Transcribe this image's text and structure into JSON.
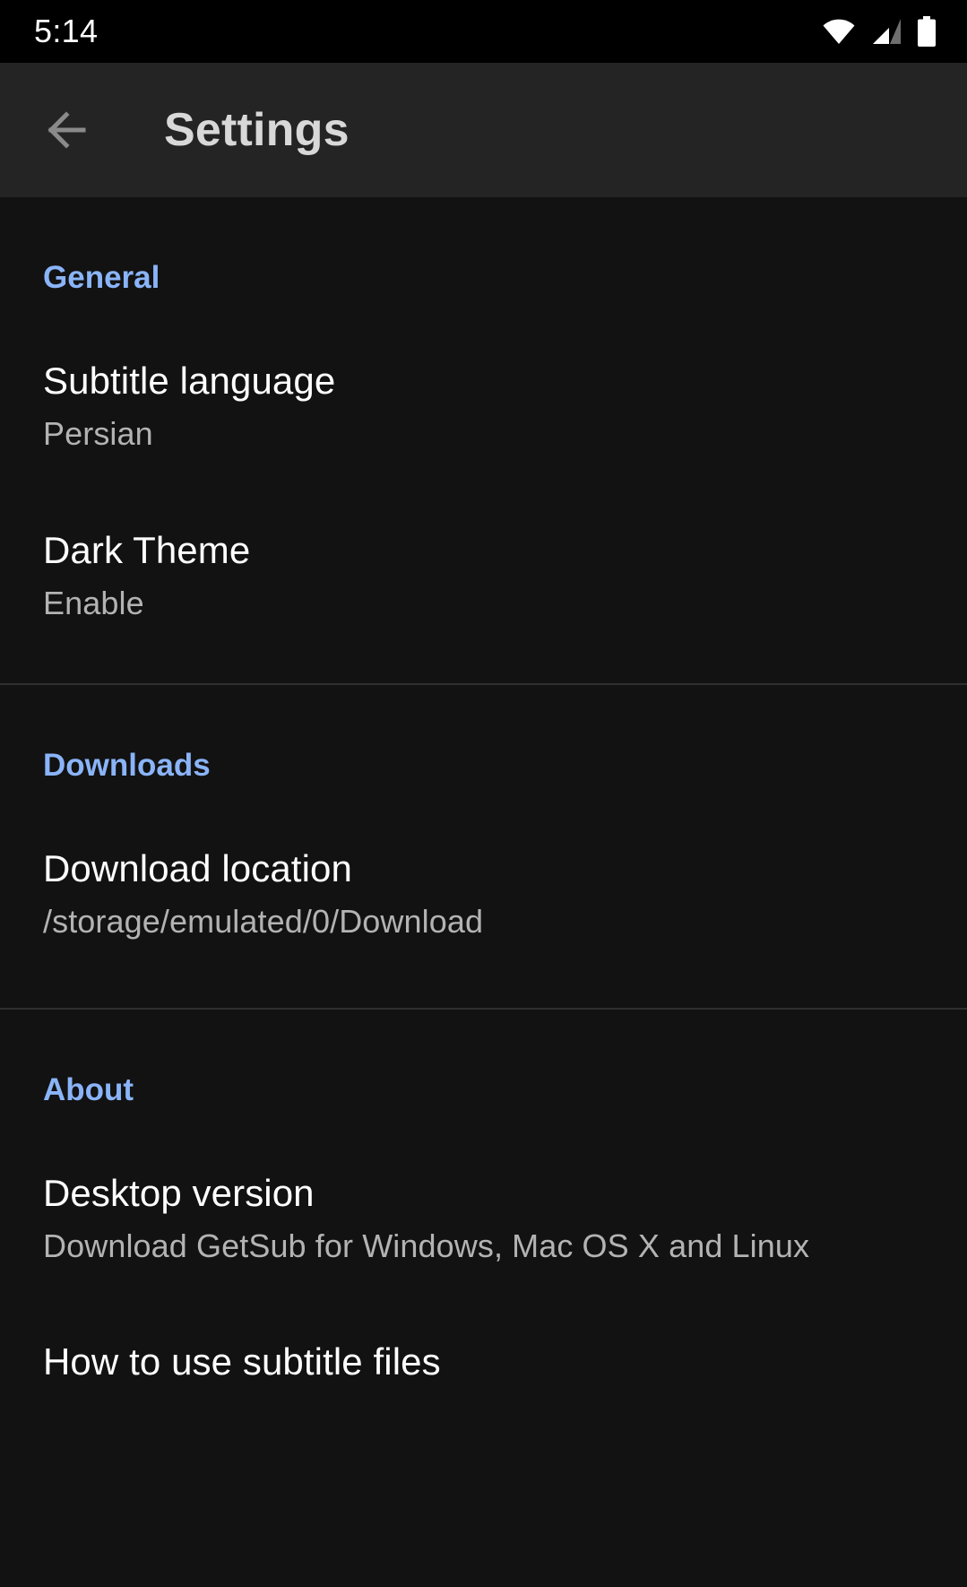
{
  "status_bar": {
    "time": "5:14",
    "icons": [
      "wifi-icon",
      "cellular-signal-icon",
      "battery-icon"
    ]
  },
  "app_bar": {
    "back_icon": "arrow-left-icon",
    "title": "Settings"
  },
  "sections": [
    {
      "header": "General",
      "items": [
        {
          "title": "Subtitle language",
          "summary": "Persian"
        },
        {
          "title": "Dark Theme",
          "summary": "Enable"
        }
      ]
    },
    {
      "header": "Downloads",
      "items": [
        {
          "title": "Download location",
          "summary": "/storage/emulated/0/Download"
        }
      ]
    },
    {
      "header": "About",
      "items": [
        {
          "title": "Desktop version",
          "summary": "Download GetSub for Windows, Mac OS X and Linux"
        },
        {
          "title": "How to use subtitle files",
          "summary": ""
        }
      ]
    }
  ],
  "colors": {
    "background": "#121212",
    "app_bar": "#242424",
    "status_bar": "#000000",
    "section_header": "#8ab4f8",
    "title": "#ffffff",
    "summary": "#b3b3b3",
    "divider": "#2e2f30",
    "back_arrow": "#8a8a8a",
    "app_title": "#d8d8d8"
  }
}
